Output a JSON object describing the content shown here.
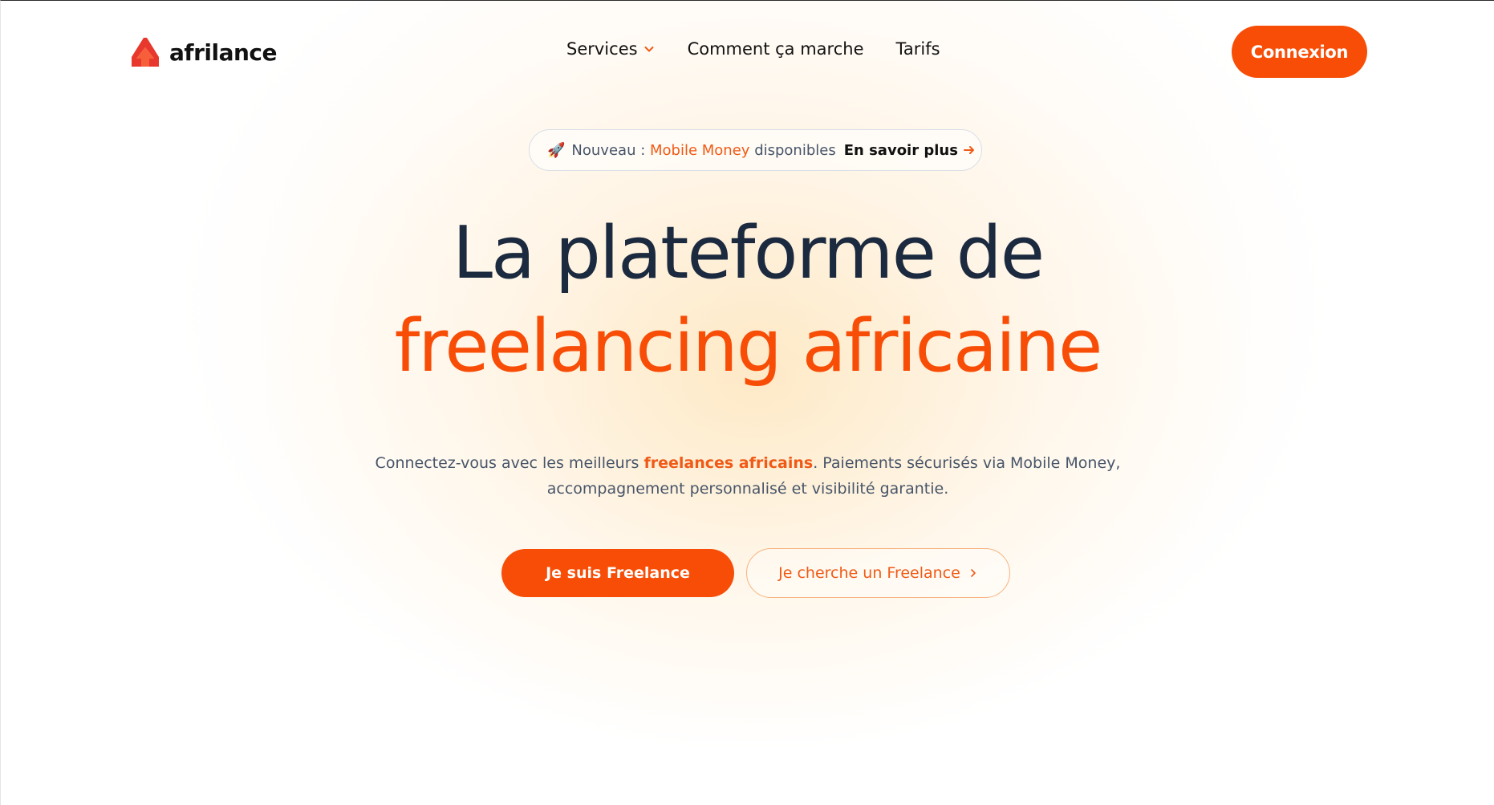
{
  "brand": {
    "name": "afrilance",
    "accent_color": "#f74d07",
    "logo_icon": "arrow-up-logo-icon"
  },
  "nav": {
    "items": [
      {
        "label": "Services",
        "has_dropdown": true
      },
      {
        "label": "Comment ça marche"
      },
      {
        "label": "Tarifs"
      }
    ],
    "login_label": "Connexion"
  },
  "announcement": {
    "icon": "rocket-icon",
    "prefix": "Nouveau :",
    "highlight": "Mobile Money",
    "suffix": "disponibles",
    "link_label": "En savoir plus"
  },
  "hero": {
    "title_line1": "La plateforme de",
    "title_line2": "freelancing africaine",
    "subtitle_pre": "Connectez-vous avec les meilleurs",
    "subtitle_highlight": "freelances africains",
    "subtitle_post": ". Paiements sécurisés via Mobile Money,",
    "subtitle_line2": "accompagnement personnalisé et visibilité garantie."
  },
  "cta": {
    "primary_label": "Je suis Freelance",
    "secondary_label": "Je cherche un Freelance"
  }
}
